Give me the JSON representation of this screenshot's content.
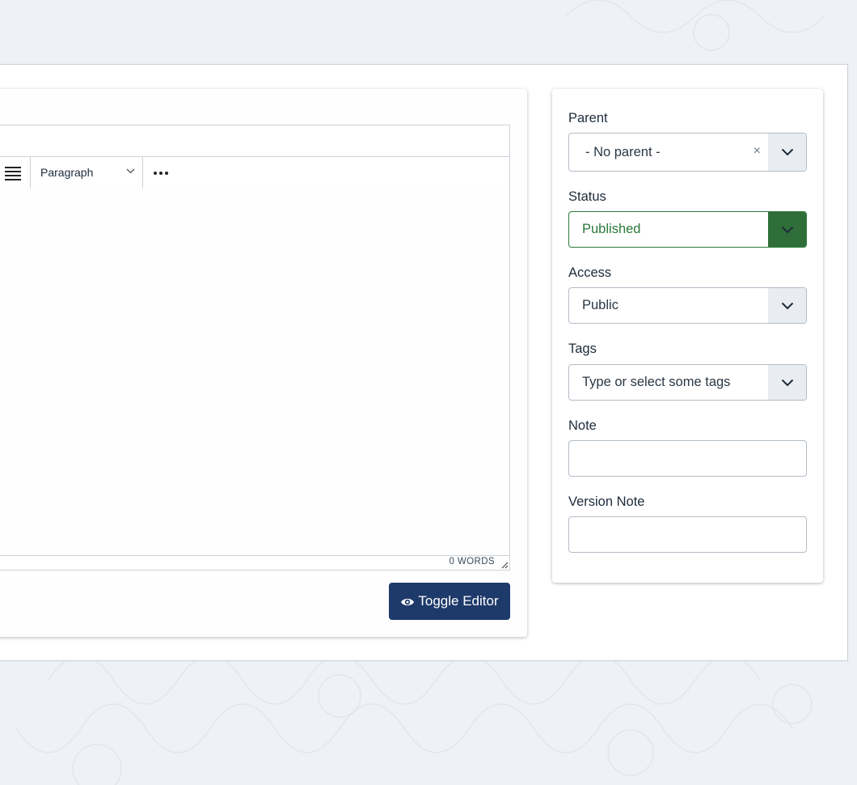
{
  "editor": {
    "toolbar": {
      "format_label": "Paragraph"
    },
    "status": {
      "word_count": "0 WORDS"
    },
    "toggle_label": "Toggle Editor"
  },
  "sidebar": {
    "parent": {
      "label": "Parent",
      "value": "- No parent -",
      "clear": "×"
    },
    "status": {
      "label": "Status",
      "value": "Published",
      "accent": "#2b7a3b"
    },
    "access": {
      "label": "Access",
      "value": "Public"
    },
    "tags": {
      "label": "Tags",
      "placeholder": "Type or select some tags"
    },
    "note": {
      "label": "Note",
      "value": ""
    },
    "version_note": {
      "label": "Version Note",
      "value": ""
    }
  },
  "colors": {
    "primary_button": "#1e3a6a",
    "published_green": "#2b7a3b",
    "page_background": "#eef1f6"
  },
  "icons": {
    "align": "align-justify-icon",
    "more": "more-horizontal-icon",
    "toggle": "eye-icon",
    "dropdown": "chevron-down-icon"
  }
}
